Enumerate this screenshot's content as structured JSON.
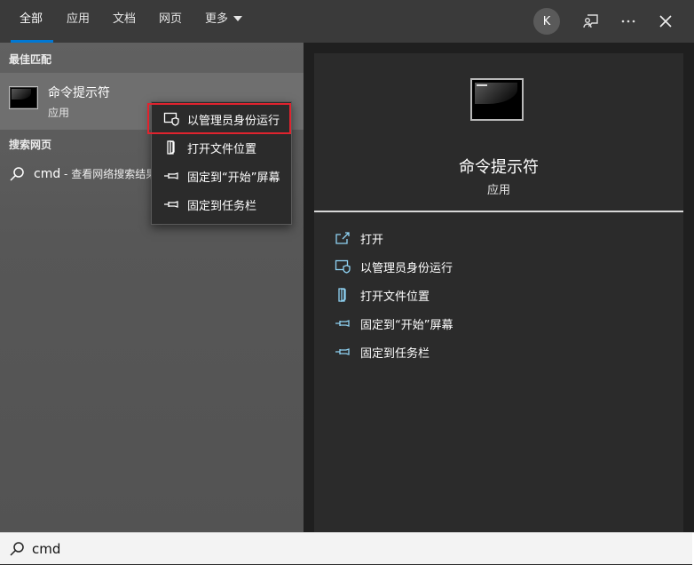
{
  "tabs": [
    {
      "label": "全部",
      "active": true
    },
    {
      "label": "应用"
    },
    {
      "label": "文档"
    },
    {
      "label": "网页"
    },
    {
      "label": "更多"
    }
  ],
  "account": {
    "initial": "K"
  },
  "left": {
    "best_match_title": "最佳匹配",
    "best": {
      "name": "命令提示符",
      "type": "应用"
    },
    "web_title": "搜索网页",
    "web_result": {
      "query": "cmd",
      "suffix": " - 查看网络搜索结果"
    }
  },
  "context_menu": {
    "items": [
      {
        "label": "以管理员身份运行",
        "icon": "shield-window-icon"
      },
      {
        "label": "打开文件位置",
        "icon": "file-location-icon"
      },
      {
        "label": "固定到“开始”屏幕",
        "icon": "pin-icon"
      },
      {
        "label": "固定到任务栏",
        "icon": "pin-icon"
      }
    ]
  },
  "detail": {
    "title": "命令提示符",
    "type": "应用",
    "actions": [
      {
        "label": "打开",
        "icon": "open-icon"
      },
      {
        "label": "以管理员身份运行",
        "icon": "shield-window-icon"
      },
      {
        "label": "打开文件位置",
        "icon": "file-location-icon"
      },
      {
        "label": "固定到“开始”屏幕",
        "icon": "pin-icon"
      },
      {
        "label": "固定到任务栏",
        "icon": "pin-icon"
      }
    ]
  },
  "search": {
    "value": "cmd"
  },
  "colors": {
    "accent": "#0078d4",
    "highlight_box": "#e0232e",
    "action_icon": "#8fd3f4"
  }
}
